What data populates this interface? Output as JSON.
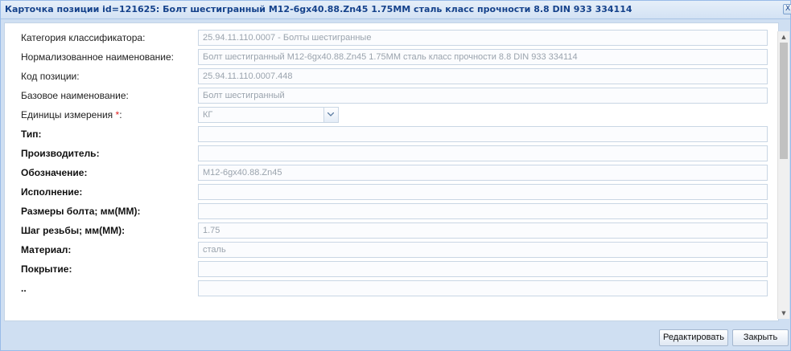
{
  "window": {
    "title": "Карточка позиции id=121625: Болт шестигранный М12-6gx40.88.Zn45 1.75ММ сталь класс прочности 8.8 DIN 933 334114",
    "close_glyph": "X"
  },
  "form": {
    "rows": [
      {
        "label": "Категория классификатора:",
        "value": "25.94.11.110.0007 - Болты шестигранные"
      },
      {
        "label": "Нормализованное наименование:",
        "value": "Болт шестигранный М12-6gx40.88.Zn45 1.75ММ сталь класс прочности 8.8 DIN 933 334114"
      },
      {
        "label": "Код позиции:",
        "value": "25.94.11.110.0007.448"
      },
      {
        "label": "Базовое наименование:",
        "value": "Болт шестигранный"
      },
      {
        "label": "Единицы измерения",
        "required_mark": "*",
        "label_suffix": ":",
        "value": "КГ"
      },
      {
        "label": "Тип:",
        "value": ""
      },
      {
        "label": "Производитель:",
        "value": ""
      },
      {
        "label": "Обозначение:",
        "value": "М12-6gx40.88.Zn45"
      },
      {
        "label": "Исполнение:",
        "value": ""
      },
      {
        "label": "Размеры болта; мм(ММ):",
        "value": ""
      },
      {
        "label": "Шаг резьбы; мм(ММ):",
        "value": "1.75"
      },
      {
        "label": "Материал:",
        "value": "сталь"
      },
      {
        "label": "Покрытие:",
        "value": ""
      },
      {
        "label": "..",
        "value": ""
      }
    ]
  },
  "footer": {
    "edit_label": "Редактировать",
    "close_label": "Закрыть"
  },
  "colors": {
    "title_text": "#15428b",
    "window_border": "#99bbe8",
    "required_mark": "#e02020"
  },
  "icons": [
    "close-icon",
    "chevron-down-icon",
    "scroll-up-icon",
    "scroll-down-icon"
  ]
}
